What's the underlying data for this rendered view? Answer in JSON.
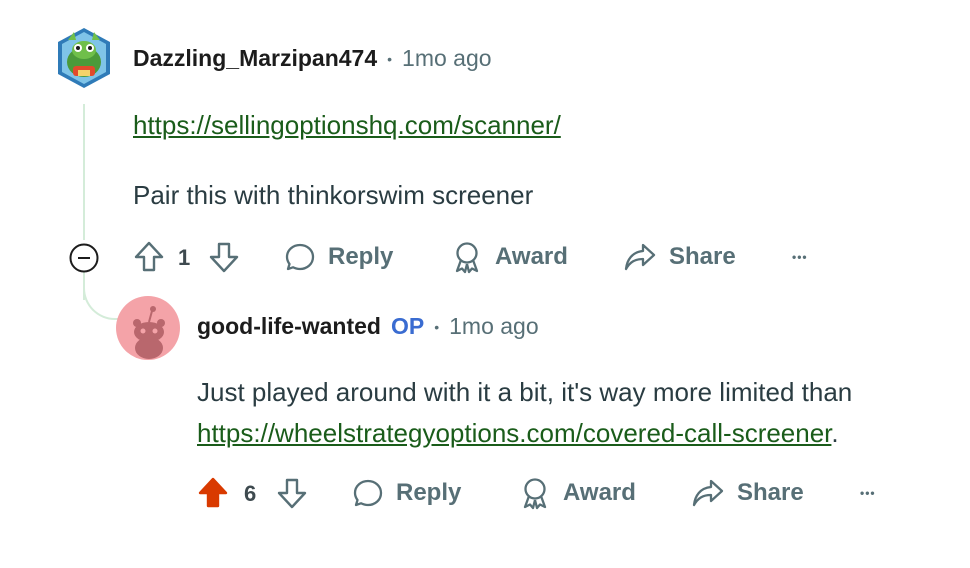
{
  "comment1": {
    "author": "Dazzling_Marzipan474",
    "dot": "•",
    "time": "1mo ago",
    "link": "https://sellingoptionshq.com/scanner/",
    "text": "Pair this with thinkorswim screener",
    "votes": "1",
    "reply": "Reply",
    "award": "Award",
    "share": "Share",
    "more": "•••"
  },
  "comment2": {
    "author": "good-life-wanted",
    "op": "OP",
    "dot": "•",
    "time": "1mo ago",
    "text": "Just played around with it a bit, it's way more limited than",
    "link": "https://wheelstrategyoptions.com/covered-call-screener",
    "link_suffix": ".",
    "votes": "6",
    "reply": "Reply",
    "award": "Award",
    "share": "Share",
    "more": "•••",
    "upvoted": true
  },
  "colors": {
    "upvote_active": "#d93a00",
    "link": "#1a5c1a",
    "op": "#3a6cd1",
    "thread": "#d4ecd9",
    "avatar2_bg": "#f4a3a8"
  },
  "icons": [
    "avatar",
    "collapse-icon",
    "upvote-icon",
    "downvote-icon",
    "reply-icon",
    "award-icon",
    "share-icon",
    "more-icon"
  ]
}
